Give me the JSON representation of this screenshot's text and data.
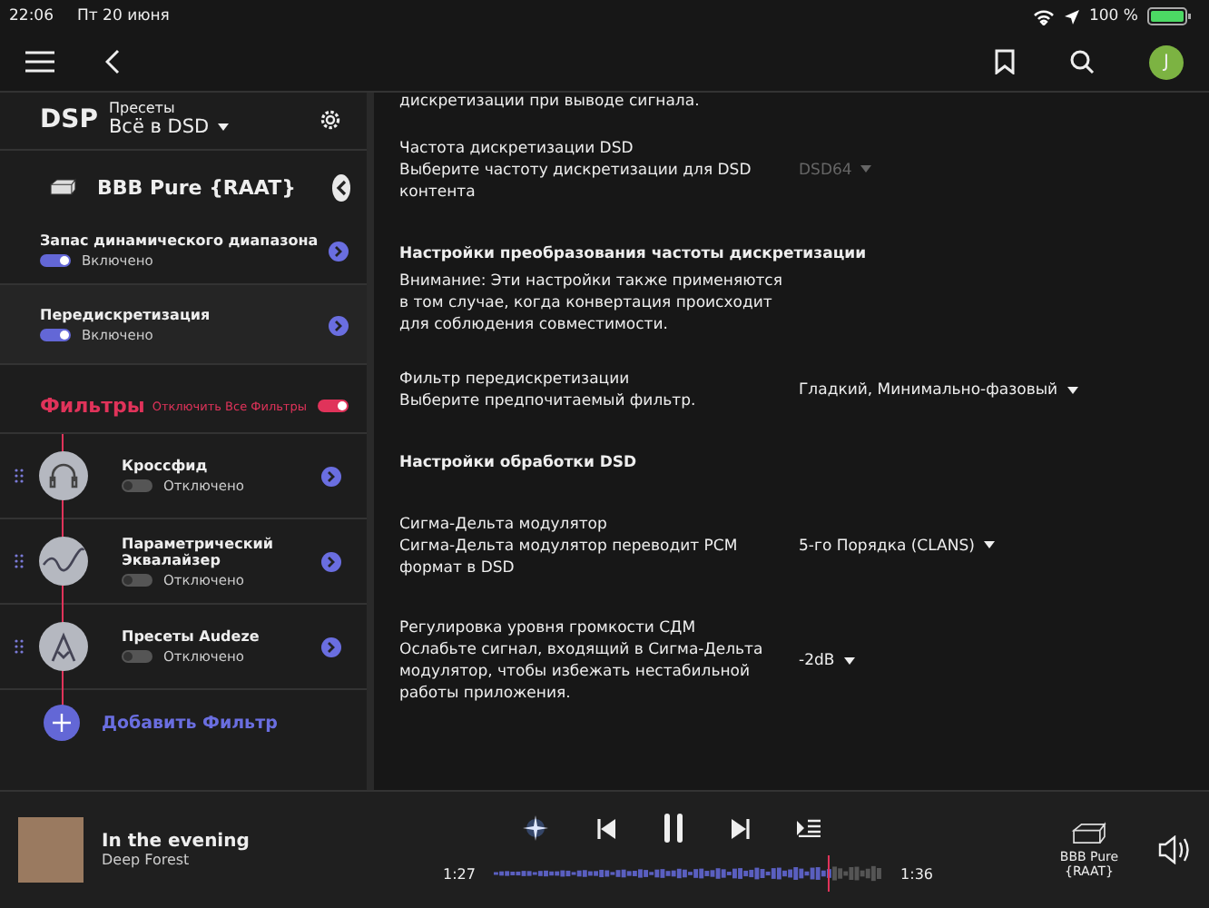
{
  "status_bar": {
    "time": "22:06",
    "date": "Пт 20 июня",
    "battery": "100 %"
  },
  "app_bar": {
    "avatar": "J"
  },
  "sidebar": {
    "dsp_label": "DSP",
    "presets_label": "Пресеты",
    "preset": "Всё в DSD",
    "device": "BBB Pure {RAAT}",
    "settings": [
      {
        "name": "Запас динамического диапазона",
        "status": "Включено",
        "on": true,
        "selected": false
      },
      {
        "name": "Передискретизация",
        "status": "Включено",
        "on": true,
        "selected": true
      }
    ],
    "filters_title": "Фильтры",
    "disable_all_label": "Отключить Все Фильтры",
    "disable_all_on": true,
    "filters": [
      {
        "name": "Кроссфид",
        "status": "Отключено",
        "on": false,
        "kind": "headphones"
      },
      {
        "name": "Параметрический Эквалайзер",
        "status": "Отключено",
        "on": false,
        "kind": "wave"
      },
      {
        "name": "Пресеты Audeze",
        "status": "Отключено",
        "on": false,
        "kind": "peak"
      }
    ],
    "add_filter": "Добавить Фильтр"
  },
  "content": {
    "top_text": "дискретизации при выводе сигнала.",
    "items": [
      {
        "kind": "option",
        "title": "Частота дискретизации DSD",
        "description": "Выберите частоту дискретизации для DSD контента",
        "value": "DSD64",
        "disabled": true
      },
      {
        "kind": "section",
        "title": "Настройки преобразования частоты дискретизации",
        "description": "Внимание: Эти настройки также применяются в том случае, когда конвертация происходит для соблюдения совместимости."
      },
      {
        "kind": "option",
        "title": "Фильтр передискретизации",
        "description": "Выберите предпочитаемый фильтр.",
        "value": "Гладкий, Минимально-фазовый",
        "disabled": false
      },
      {
        "kind": "section",
        "title": "Настройки обработки DSD"
      },
      {
        "kind": "option",
        "title": "Сигма-Дельта модулятор",
        "description": "Сигма-Дельта модулятор переводит PCM формат в DSD",
        "value": "5-го Порядка (CLANS)",
        "disabled": false
      },
      {
        "kind": "option",
        "title": "Регулировка уровня громкости СДМ",
        "description": "Ослабьте сигнал, входящий в Сигма-Дельта модулятор, чтобы избежать нестабильной работы приложения.",
        "value": "-2dB",
        "disabled": false
      }
    ]
  },
  "player": {
    "title": "In the evening",
    "artist": "Deep Forest",
    "elapsed": "1:27",
    "total": "1:36",
    "level": 0.86,
    "device": "BBB Pure {RAAT}"
  }
}
